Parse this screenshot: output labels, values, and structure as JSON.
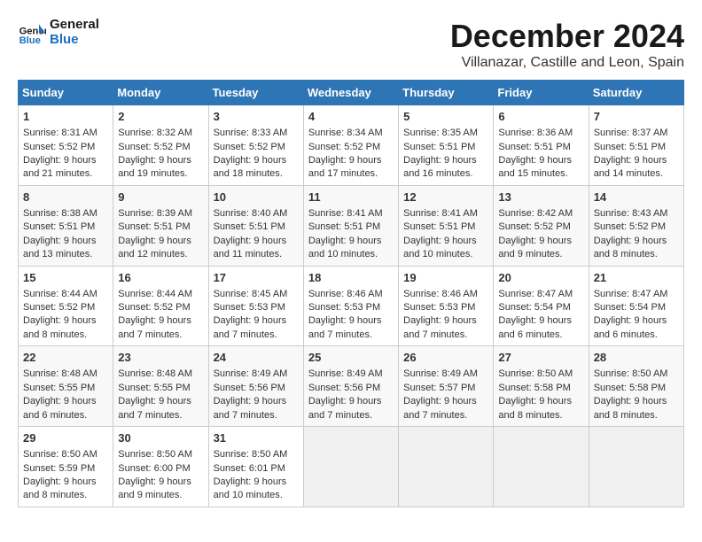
{
  "header": {
    "logo_line1": "General",
    "logo_line2": "Blue",
    "month": "December 2024",
    "location": "Villanazar, Castille and Leon, Spain"
  },
  "weekdays": [
    "Sunday",
    "Monday",
    "Tuesday",
    "Wednesday",
    "Thursday",
    "Friday",
    "Saturday"
  ],
  "weeks": [
    [
      {
        "day": "1",
        "sunrise": "8:31 AM",
        "sunset": "5:52 PM",
        "daylight": "9 hours and 21 minutes."
      },
      {
        "day": "2",
        "sunrise": "8:32 AM",
        "sunset": "5:52 PM",
        "daylight": "9 hours and 19 minutes."
      },
      {
        "day": "3",
        "sunrise": "8:33 AM",
        "sunset": "5:52 PM",
        "daylight": "9 hours and 18 minutes."
      },
      {
        "day": "4",
        "sunrise": "8:34 AM",
        "sunset": "5:52 PM",
        "daylight": "9 hours and 17 minutes."
      },
      {
        "day": "5",
        "sunrise": "8:35 AM",
        "sunset": "5:51 PM",
        "daylight": "9 hours and 16 minutes."
      },
      {
        "day": "6",
        "sunrise": "8:36 AM",
        "sunset": "5:51 PM",
        "daylight": "9 hours and 15 minutes."
      },
      {
        "day": "7",
        "sunrise": "8:37 AM",
        "sunset": "5:51 PM",
        "daylight": "9 hours and 14 minutes."
      }
    ],
    [
      {
        "day": "8",
        "sunrise": "8:38 AM",
        "sunset": "5:51 PM",
        "daylight": "9 hours and 13 minutes."
      },
      {
        "day": "9",
        "sunrise": "8:39 AM",
        "sunset": "5:51 PM",
        "daylight": "9 hours and 12 minutes."
      },
      {
        "day": "10",
        "sunrise": "8:40 AM",
        "sunset": "5:51 PM",
        "daylight": "9 hours and 11 minutes."
      },
      {
        "day": "11",
        "sunrise": "8:41 AM",
        "sunset": "5:51 PM",
        "daylight": "9 hours and 10 minutes."
      },
      {
        "day": "12",
        "sunrise": "8:41 AM",
        "sunset": "5:51 PM",
        "daylight": "9 hours and 10 minutes."
      },
      {
        "day": "13",
        "sunrise": "8:42 AM",
        "sunset": "5:52 PM",
        "daylight": "9 hours and 9 minutes."
      },
      {
        "day": "14",
        "sunrise": "8:43 AM",
        "sunset": "5:52 PM",
        "daylight": "9 hours and 8 minutes."
      }
    ],
    [
      {
        "day": "15",
        "sunrise": "8:44 AM",
        "sunset": "5:52 PM",
        "daylight": "9 hours and 8 minutes."
      },
      {
        "day": "16",
        "sunrise": "8:44 AM",
        "sunset": "5:52 PM",
        "daylight": "9 hours and 7 minutes."
      },
      {
        "day": "17",
        "sunrise": "8:45 AM",
        "sunset": "5:53 PM",
        "daylight": "9 hours and 7 minutes."
      },
      {
        "day": "18",
        "sunrise": "8:46 AM",
        "sunset": "5:53 PM",
        "daylight": "9 hours and 7 minutes."
      },
      {
        "day": "19",
        "sunrise": "8:46 AM",
        "sunset": "5:53 PM",
        "daylight": "9 hours and 7 minutes."
      },
      {
        "day": "20",
        "sunrise": "8:47 AM",
        "sunset": "5:54 PM",
        "daylight": "9 hours and 6 minutes."
      },
      {
        "day": "21",
        "sunrise": "8:47 AM",
        "sunset": "5:54 PM",
        "daylight": "9 hours and 6 minutes."
      }
    ],
    [
      {
        "day": "22",
        "sunrise": "8:48 AM",
        "sunset": "5:55 PM",
        "daylight": "9 hours and 6 minutes."
      },
      {
        "day": "23",
        "sunrise": "8:48 AM",
        "sunset": "5:55 PM",
        "daylight": "9 hours and 7 minutes."
      },
      {
        "day": "24",
        "sunrise": "8:49 AM",
        "sunset": "5:56 PM",
        "daylight": "9 hours and 7 minutes."
      },
      {
        "day": "25",
        "sunrise": "8:49 AM",
        "sunset": "5:56 PM",
        "daylight": "9 hours and 7 minutes."
      },
      {
        "day": "26",
        "sunrise": "8:49 AM",
        "sunset": "5:57 PM",
        "daylight": "9 hours and 7 minutes."
      },
      {
        "day": "27",
        "sunrise": "8:50 AM",
        "sunset": "5:58 PM",
        "daylight": "9 hours and 8 minutes."
      },
      {
        "day": "28",
        "sunrise": "8:50 AM",
        "sunset": "5:58 PM",
        "daylight": "9 hours and 8 minutes."
      }
    ],
    [
      {
        "day": "29",
        "sunrise": "8:50 AM",
        "sunset": "5:59 PM",
        "daylight": "9 hours and 8 minutes."
      },
      {
        "day": "30",
        "sunrise": "8:50 AM",
        "sunset": "6:00 PM",
        "daylight": "9 hours and 9 minutes."
      },
      {
        "day": "31",
        "sunrise": "8:50 AM",
        "sunset": "6:01 PM",
        "daylight": "9 hours and 10 minutes."
      },
      null,
      null,
      null,
      null
    ]
  ],
  "labels": {
    "sunrise": "Sunrise:",
    "sunset": "Sunset:",
    "daylight": "Daylight:"
  }
}
